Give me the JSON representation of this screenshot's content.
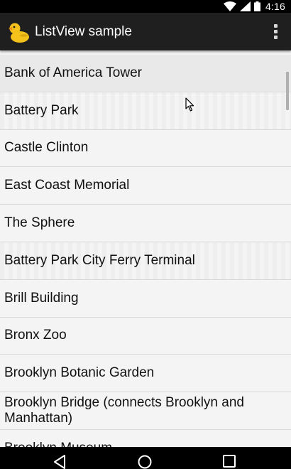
{
  "status_bar": {
    "time": "4:16",
    "icons": [
      "wifi-icon",
      "signal-icon",
      "battery-icon"
    ]
  },
  "action_bar": {
    "title": "ListView sample",
    "app_icon": "duck-icon",
    "overflow_icon": "overflow-menu-icon"
  },
  "list": {
    "items": [
      "Bank of America Tower",
      "Battery Park",
      "Castle Clinton",
      "East Coast Memorial",
      "The Sphere",
      "Battery Park City Ferry Terminal",
      "Brill Building",
      "Bronx Zoo",
      "Brooklyn Botanic Garden",
      "Brooklyn Bridge (connects Brooklyn and Manhattan)",
      "Brooklyn Museum"
    ]
  },
  "nav_bar": {
    "icons": [
      "back-icon",
      "home-icon",
      "recents-icon"
    ]
  },
  "colors": {
    "status_bar": "#000000",
    "action_bar": "#1f1f1f",
    "list_background": "#f4f4f4",
    "divider": "#d9d9d9",
    "text": "#111111"
  }
}
